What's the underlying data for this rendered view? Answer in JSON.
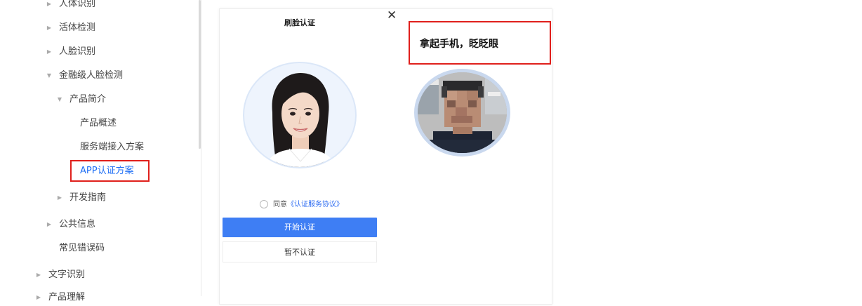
{
  "sidebar": {
    "items": [
      {
        "label": "人体识别",
        "arrow": "right"
      },
      {
        "label": "活体检测",
        "arrow": "right"
      },
      {
        "label": "人脸识别",
        "arrow": "right"
      },
      {
        "label": "金融级人脸检测",
        "arrow": "down"
      },
      {
        "label": "产品简介",
        "arrow": "down"
      },
      {
        "label": "产品概述"
      },
      {
        "label": "服务端接入方案"
      },
      {
        "label": "APP认证方案",
        "active": true
      },
      {
        "label": "开发指南",
        "arrow": "right"
      },
      {
        "label": "公共信息",
        "arrow": "right"
      },
      {
        "label": "常见错误码"
      },
      {
        "label": "文字识别",
        "arrow": "right"
      },
      {
        "label": "产品理解",
        "arrow": "right"
      }
    ]
  },
  "verify_screen": {
    "close_icon": "✕",
    "title": "刷脸认证",
    "agree_prefix": "同意",
    "agree_link": "《认证服务协议》",
    "start_button": "开始认证",
    "later_button": "暂不认证"
  },
  "liveness_screen": {
    "tip": "拿起手机，眨眨眼"
  },
  "colors": {
    "accent": "#3e7ef4",
    "link": "#2f6df2",
    "highlight_box": "#e0201c",
    "active_nav": "#1f6ff5"
  }
}
